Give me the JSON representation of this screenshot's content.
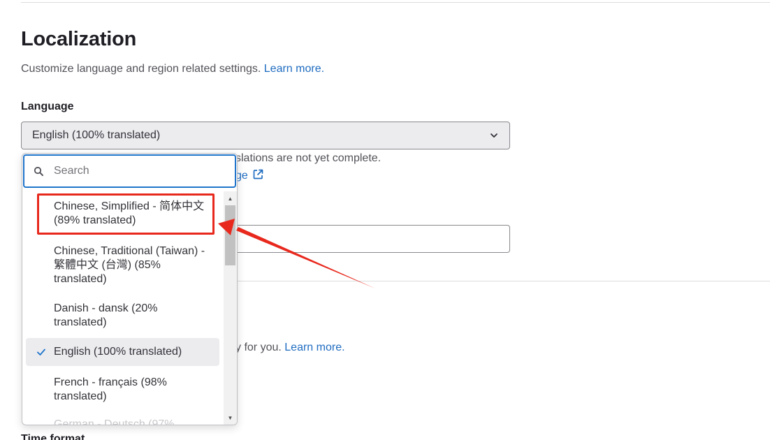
{
  "page": {
    "title": "Localization",
    "subtitle": "Customize language and region related settings.",
    "subtitle_link": "Learn more."
  },
  "language": {
    "label": "Language",
    "selected": "English (100% translated)",
    "help_text_partial": "slations are not yet complete.",
    "help_link_partial": "ge"
  },
  "timezone": {
    "help_text_partial": "y for you.",
    "help_link": "Learn more."
  },
  "time_format": {
    "label": "Time format"
  },
  "dropdown": {
    "search_placeholder": "Search",
    "options": [
      {
        "label": "Chinese, Simplified - 简体中文 (89% translated)",
        "selected": false,
        "highlighted": true
      },
      {
        "label": "Chinese, Traditional (Taiwan) - 繁體中文 (台灣) (85% translated)",
        "selected": false,
        "highlighted": false
      },
      {
        "label": "Danish - dansk (20% translated)",
        "selected": false,
        "highlighted": false
      },
      {
        "label": "English (100% translated)",
        "selected": true,
        "highlighted": false
      },
      {
        "label": "French - français (98% translated)",
        "selected": false,
        "highlighted": false
      },
      {
        "label": "German - Deutsch (97%",
        "selected": false,
        "highlighted": false
      }
    ]
  },
  "colors": {
    "link": "#1f6cc1",
    "focus_border": "#1f75cb",
    "annotation": "#e8281d",
    "selected_bg": "#ececef"
  },
  "icons": {
    "search": "search-icon",
    "chevron": "chevron-down-icon",
    "check": "check-icon",
    "external": "external-link-icon"
  }
}
